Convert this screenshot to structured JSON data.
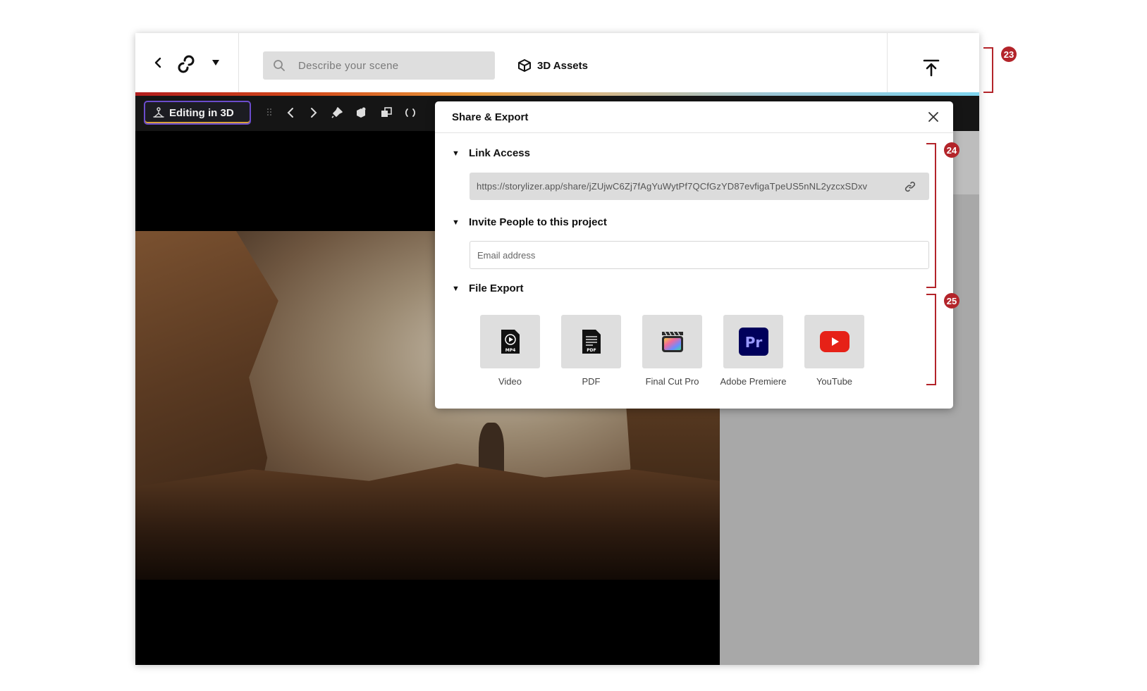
{
  "topbar": {
    "search_placeholder": "Describe your scene",
    "assets_label": "3D Assets"
  },
  "toolbar": {
    "mode_label": "Editing in 3D"
  },
  "dialog": {
    "title": "Share & Export",
    "link_access": {
      "label": "Link Access",
      "url": "https://storylizer.app/share/jZUjwC6Zj7fAgYuWytPf7QCfGzYD87evfigaTpeUS5nNL2yzcxSDxv"
    },
    "invite": {
      "label": "Invite People to this project",
      "placeholder": "Email address"
    },
    "file_export": {
      "label": "File Export",
      "items": [
        {
          "label": "Video",
          "icon": "mp4-file-icon",
          "badge": "MP4"
        },
        {
          "label": "PDF",
          "icon": "pdf-file-icon",
          "badge": "PDF"
        },
        {
          "label": "Final Cut Pro",
          "icon": "final-cut-pro-icon"
        },
        {
          "label": "Adobe Premiere",
          "icon": "adobe-premiere-icon",
          "badge": "Pr"
        },
        {
          "label": "YouTube",
          "icon": "youtube-icon"
        }
      ]
    }
  },
  "callouts": {
    "c1": "23",
    "c2": "24",
    "c3": "25"
  },
  "colors": {
    "callout": "#b3242a",
    "premiere_bg": "#00005b",
    "premiere_text": "#9999ff",
    "youtube": "#e62117"
  }
}
